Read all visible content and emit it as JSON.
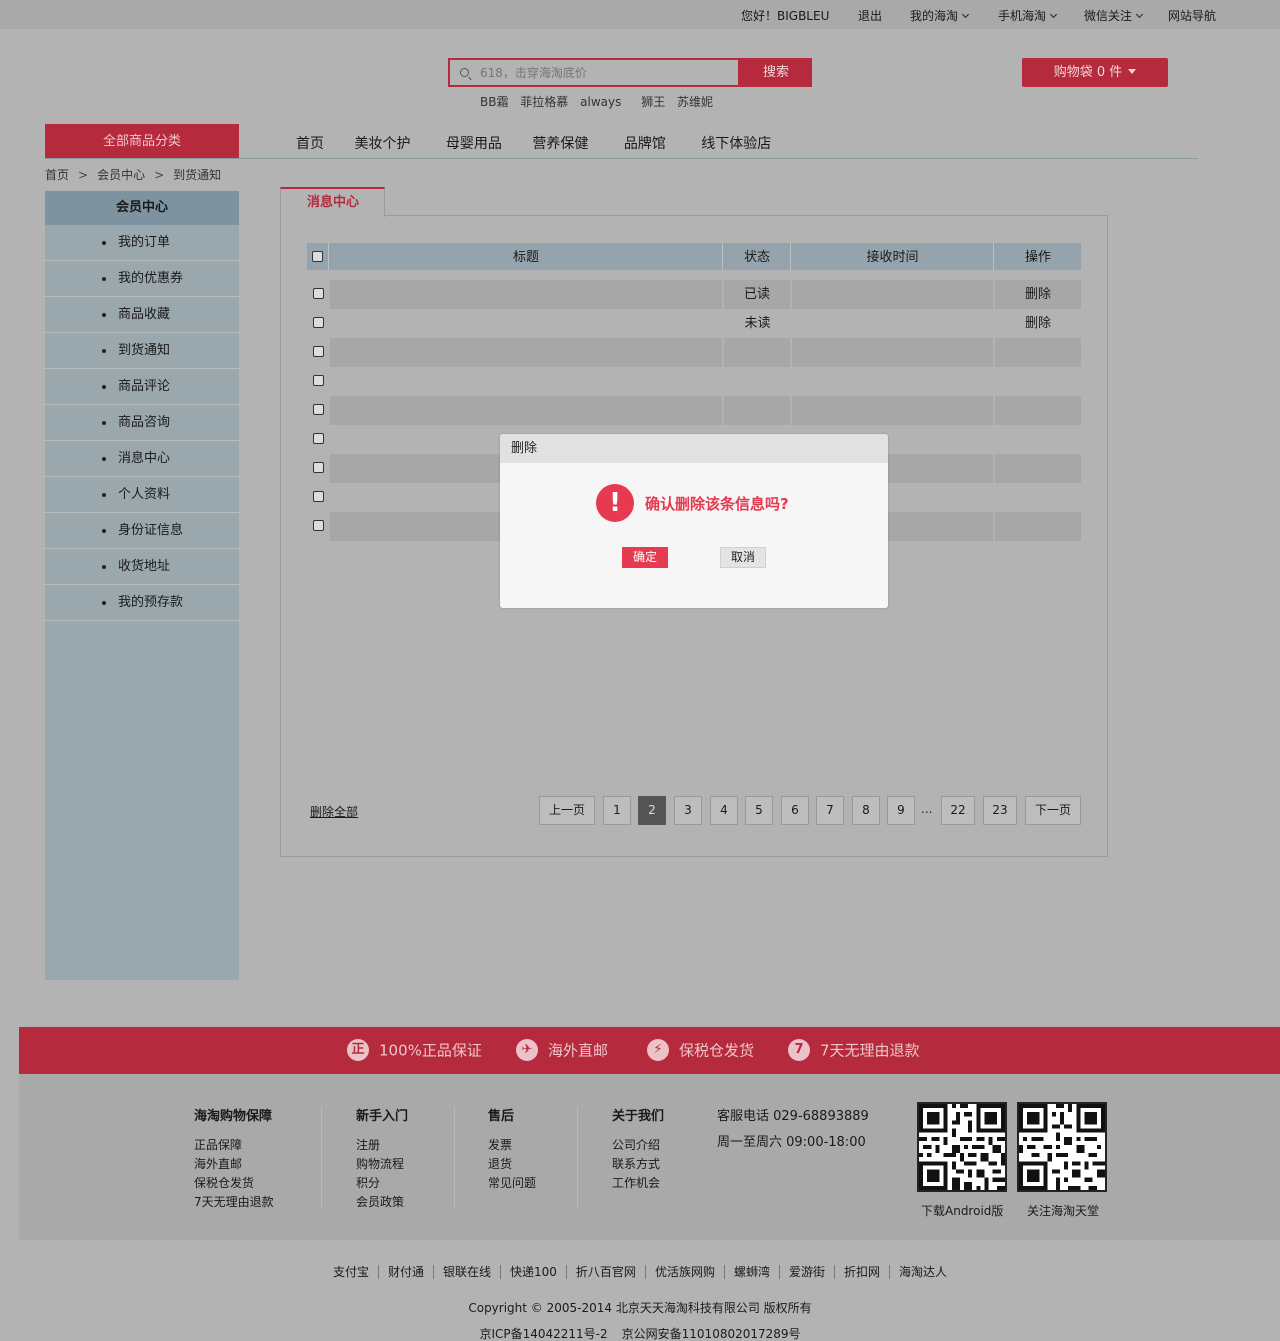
{
  "topbar": {
    "greeting": "您好！BIGBLEU",
    "logout": "退出",
    "my_haitao": "我的海淘",
    "mobile": "手机海淘",
    "wechat": "微信关注",
    "sitenav": "网站导航"
  },
  "search": {
    "placeholder": "618，击穿海淘底价",
    "button": "搜索",
    "hotwords": [
      "BB霜",
      "菲拉格慕",
      "always",
      "狮王",
      "苏维妮"
    ]
  },
  "cart": {
    "label": "购物袋 0 件"
  },
  "nav": {
    "all_categories": "全部商品分类",
    "items": [
      "首页",
      "美妆个护",
      "母婴用品",
      "营养保健",
      "品牌馆",
      "线下体验店"
    ]
  },
  "breadcrumb": [
    "首页",
    "会员中心",
    "到货通知"
  ],
  "breadcrumb_sep": ">",
  "sidebar": {
    "header": "会员中心",
    "items": [
      "我的订单",
      "我的优惠券",
      "商品收藏",
      "到货通知",
      "商品评论",
      "商品咨询",
      "消息中心",
      "个人资料",
      "身份证信息",
      "收货地址",
      "我的预存款"
    ]
  },
  "panel": {
    "tab": "消息中心",
    "columns": [
      "标题",
      "状态",
      "接收时间",
      "操作"
    ],
    "rows": [
      {
        "title": "",
        "status": "已读",
        "time": "",
        "action": "删除"
      },
      {
        "title": "",
        "status": "未读",
        "time": "",
        "action": "删除"
      },
      {
        "title": "",
        "status": "",
        "time": "",
        "action": ""
      },
      {
        "title": "",
        "status": "",
        "time": "",
        "action": ""
      },
      {
        "title": "",
        "status": "",
        "time": "",
        "action": ""
      },
      {
        "title": "",
        "status": "",
        "time": "",
        "action": ""
      },
      {
        "title": "",
        "status": "",
        "time": "",
        "action": ""
      },
      {
        "title": "",
        "status": "",
        "time": "",
        "action": ""
      },
      {
        "title": "",
        "status": "",
        "time": "",
        "action": ""
      }
    ],
    "delete_all": "删除全部",
    "pager": {
      "prev": "上一页",
      "next": "下一页",
      "pages": [
        "1",
        "2",
        "3",
        "4",
        "5",
        "6",
        "7",
        "8",
        "9"
      ],
      "ellipsis": "...",
      "tail": [
        "22",
        "23"
      ],
      "current": "2"
    }
  },
  "dialog": {
    "title": "删除",
    "icon": "!",
    "message": "确认删除该条信息吗?",
    "ok": "确定",
    "cancel": "取消",
    "accent": "#e53a50"
  },
  "guarantees": [
    {
      "icon": "正",
      "text": "100%正品保证"
    },
    {
      "icon": "✈",
      "text": "海外直邮"
    },
    {
      "icon": "⚡",
      "text": "保税仓发货"
    },
    {
      "icon": "7",
      "text": "7天无理由退款"
    }
  ],
  "footer": {
    "columns": [
      {
        "title": "海淘购物保障",
        "links": [
          "正品保障",
          "海外直邮",
          "保税仓发货",
          "7天无理由退款"
        ]
      },
      {
        "title": "新手入门",
        "links": [
          "注册",
          "购物流程",
          "积分",
          "会员政策"
        ]
      },
      {
        "title": "售后",
        "links": [
          "发票",
          "退货",
          "常见问题"
        ]
      },
      {
        "title": "关于我们",
        "links": [
          "公司介绍",
          "联系方式",
          "工作机会"
        ]
      }
    ],
    "phone": "客服电话 029-68893889",
    "hours": "周一至周六 09:00-18:00",
    "qr_android": "下载Android版",
    "qr_follow": "关注海淘天堂",
    "links": [
      "支付宝",
      "财付通",
      "银联在线",
      "快递100",
      "折八百官网",
      "优活族网购",
      "螺蛳湾",
      "爱游街",
      "折扣网",
      "海淘达人"
    ],
    "copyright": "Copyright © 2005-2014 北京天天海淘科技有限公司 版权所有",
    "icp": "京ICP备14042211号-2",
    "police": "京公网安备11010802017289号"
  },
  "colors": {
    "brand": "#b52a3c",
    "overlay_bg": "#b3b3b3"
  }
}
